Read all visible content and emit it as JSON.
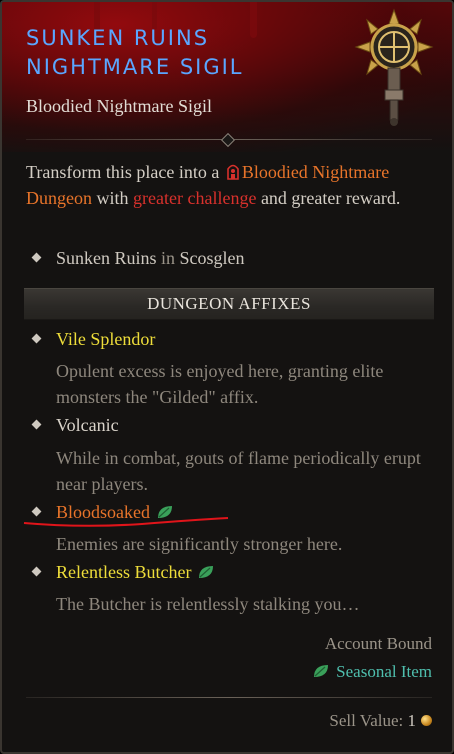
{
  "item": {
    "title_line1": "Sunken Ruins",
    "title_line2": "Nightmare Sigil",
    "subtitle": "Bloodied Nightmare Sigil",
    "icon": "sigil-icon"
  },
  "description": {
    "part1": "Transform this place into a",
    "dungeon_type": "Bloodied Nightmare Dungeon",
    "part2": "with",
    "challenge": "greater challenge",
    "part3": "and greater reward.",
    "dungeon_icon": "bloodied-dungeon-icon"
  },
  "location": {
    "dungeon": "Sunken Ruins",
    "connector": "in",
    "region": "Scosglen"
  },
  "affixes_header": "DUNGEON AFFIXES",
  "affixes": [
    {
      "name": "Vile Splendor",
      "description": "Opulent excess is enjoyed here, granting elite monsters the \"Gilded\" affix.",
      "name_color": "#eedd3a"
    },
    {
      "name": "Volcanic",
      "description": "While in combat, gouts of flame periodically erupt near players.",
      "name_color": "#d9d3ca"
    },
    {
      "name": "Bloodsoaked",
      "description": "Enemies are significantly stronger here.",
      "name_color": "#e8742a",
      "seasonal_icon": "leaf-icon"
    },
    {
      "name": "Relentless Butcher",
      "description": "The Butcher is relentlessly stalking you…",
      "name_color": "#eedd3a",
      "seasonal_icon": "leaf-icon"
    }
  ],
  "footer": {
    "account_bound": "Account Bound",
    "seasonal": "Seasonal Item",
    "seasonal_icon": "leaf-icon",
    "sell_label": "Sell Value:",
    "sell_value": "1",
    "coin_icon": "gold-coin-icon"
  },
  "colors": {
    "title": "#5aa6ff",
    "orange": "#e8742a",
    "red": "#d8312c",
    "yellow": "#eedd3a",
    "teal": "#4fbfae"
  }
}
